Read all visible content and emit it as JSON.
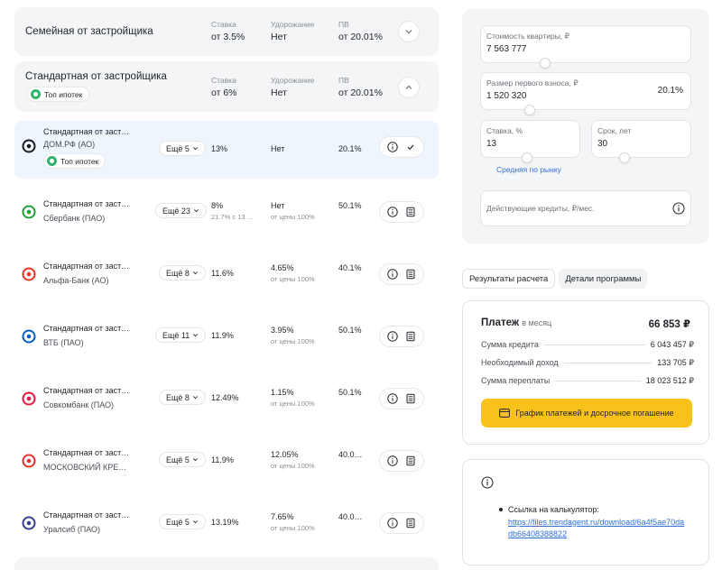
{
  "groups": [
    {
      "title": "Семейная от застройщика",
      "rate_label": "Ставка",
      "rate_value": "от 3.5%",
      "markup_label": "Удорожание",
      "markup_value": "Нет",
      "down_label": "ПВ",
      "down_value": "от 20.01%",
      "toggle_icon": "chevron-down-icon"
    },
    {
      "title": "Стандартная от застройщика",
      "badge": "Топ ипотек",
      "rate_label": "Ставка",
      "rate_value": "от 6%",
      "markup_label": "Удорожание",
      "markup_value": "Нет",
      "down_label": "ПВ",
      "down_value": "от 20.01%",
      "toggle_icon": "chevron-up-icon"
    }
  ],
  "offers": [
    {
      "program": "Стандартная от заст…",
      "bank": "ДОМ.РФ (АО)",
      "badge": "Топ ипотек",
      "more": "Ещё 5",
      "rate": "13%",
      "rate_sub": "",
      "markup": "Нет",
      "markup_sub": "",
      "down": "20.1%",
      "selected": true,
      "logo_color": "#1a1a1a"
    },
    {
      "program": "Стандартная от заст…",
      "bank": "Сбербанк (ПАО)",
      "badge": "",
      "more": "Ещё 23",
      "rate": "8%",
      "rate_sub": "21.7% с 13 …",
      "markup": "Нет",
      "markup_sub": "от цены 100%",
      "down": "50.1%",
      "selected": false,
      "logo_color": "#21a038"
    },
    {
      "program": "Стандартная от заст…",
      "bank": "Альфа-Банк (АО)",
      "badge": "",
      "more": "Ещё 8",
      "rate": "11.6%",
      "rate_sub": "",
      "markup": "4.65%",
      "markup_sub": "от цены 100%",
      "down": "40.1%",
      "selected": false,
      "logo_color": "#ef3124"
    },
    {
      "program": "Стандартная от заст…",
      "bank": "ВТБ (ПАО)",
      "badge": "",
      "more": "Ещё 11",
      "rate": "11.9%",
      "rate_sub": "",
      "markup": "3.95%",
      "markup_sub": "от цены 100%",
      "down": "50.1%",
      "selected": false,
      "logo_color": "#0a5fc1"
    },
    {
      "program": "Стандартная от заст…",
      "bank": "Совкомбанк (ПАО)",
      "badge": "",
      "more": "Ещё 8",
      "rate": "12.49%",
      "rate_sub": "",
      "markup": "1.15%",
      "markup_sub": "от цены 100%",
      "down": "50.1%",
      "selected": false,
      "logo_color": "#e4163a"
    },
    {
      "program": "Стандартная от заст…",
      "bank": "МОСКОВСКИЙ КРЕ…",
      "badge": "",
      "more": "Ещё 5",
      "rate": "11.9%",
      "rate_sub": "",
      "markup": "12.05%",
      "markup_sub": "от цены 100%",
      "down": "40.0…",
      "selected": false,
      "logo_color": "#e5322d"
    },
    {
      "program": "Стандартная от заст…",
      "bank": "Уралсиб (ПАО)",
      "badge": "",
      "more": "Ещё 5",
      "rate": "13.19%",
      "rate_sub": "",
      "markup": "7.65%",
      "markup_sub": "от цены 100%",
      "down": "40.0…",
      "selected": false,
      "logo_color": "#3a3f8f"
    }
  ],
  "calculator": {
    "price_label": "Стоимость квартиры, ₽",
    "price_value": "7 563 777",
    "price_level": 0.28,
    "down_label": "Размер первого взноса, ₽",
    "down_value": "1 520 320",
    "down_percent": "20.1%",
    "down_level": 0.2,
    "rate_label": "Ставка, %",
    "rate_value": "13",
    "rate_level": 0.45,
    "term_label": "Срок, лет",
    "term_value": "30",
    "term_level": 0.28,
    "avg_link": "Средняя по рынку",
    "existing_label": "Действующие кредиты, ₽/мес."
  },
  "tabs": [
    "Результаты расчета",
    "Детали программы"
  ],
  "results": {
    "monthly_label": "Платеж",
    "monthly_suffix": "в месяц",
    "monthly_value": "66 853 ₽",
    "lines": [
      {
        "label": "Сумма кредита",
        "value": "6 043 457 ₽"
      },
      {
        "label": "Необходимый доход",
        "value": "133 705 ₽"
      },
      {
        "label": "Сумма переплаты",
        "value": "18 023 512 ₽"
      }
    ],
    "schedule_button": "График платежей и досрочное погашение"
  },
  "note": {
    "text": "Ссылка на калькулятор:",
    "link": "https://files.trendagent.ru/download/6a4f5ae70dadb66408388822"
  },
  "colors": {
    "accent_yellow": "#f8c21a",
    "link_blue": "#2f6fd6",
    "badge_green": "#2fb36b",
    "selected_row": "#eef5fd"
  }
}
